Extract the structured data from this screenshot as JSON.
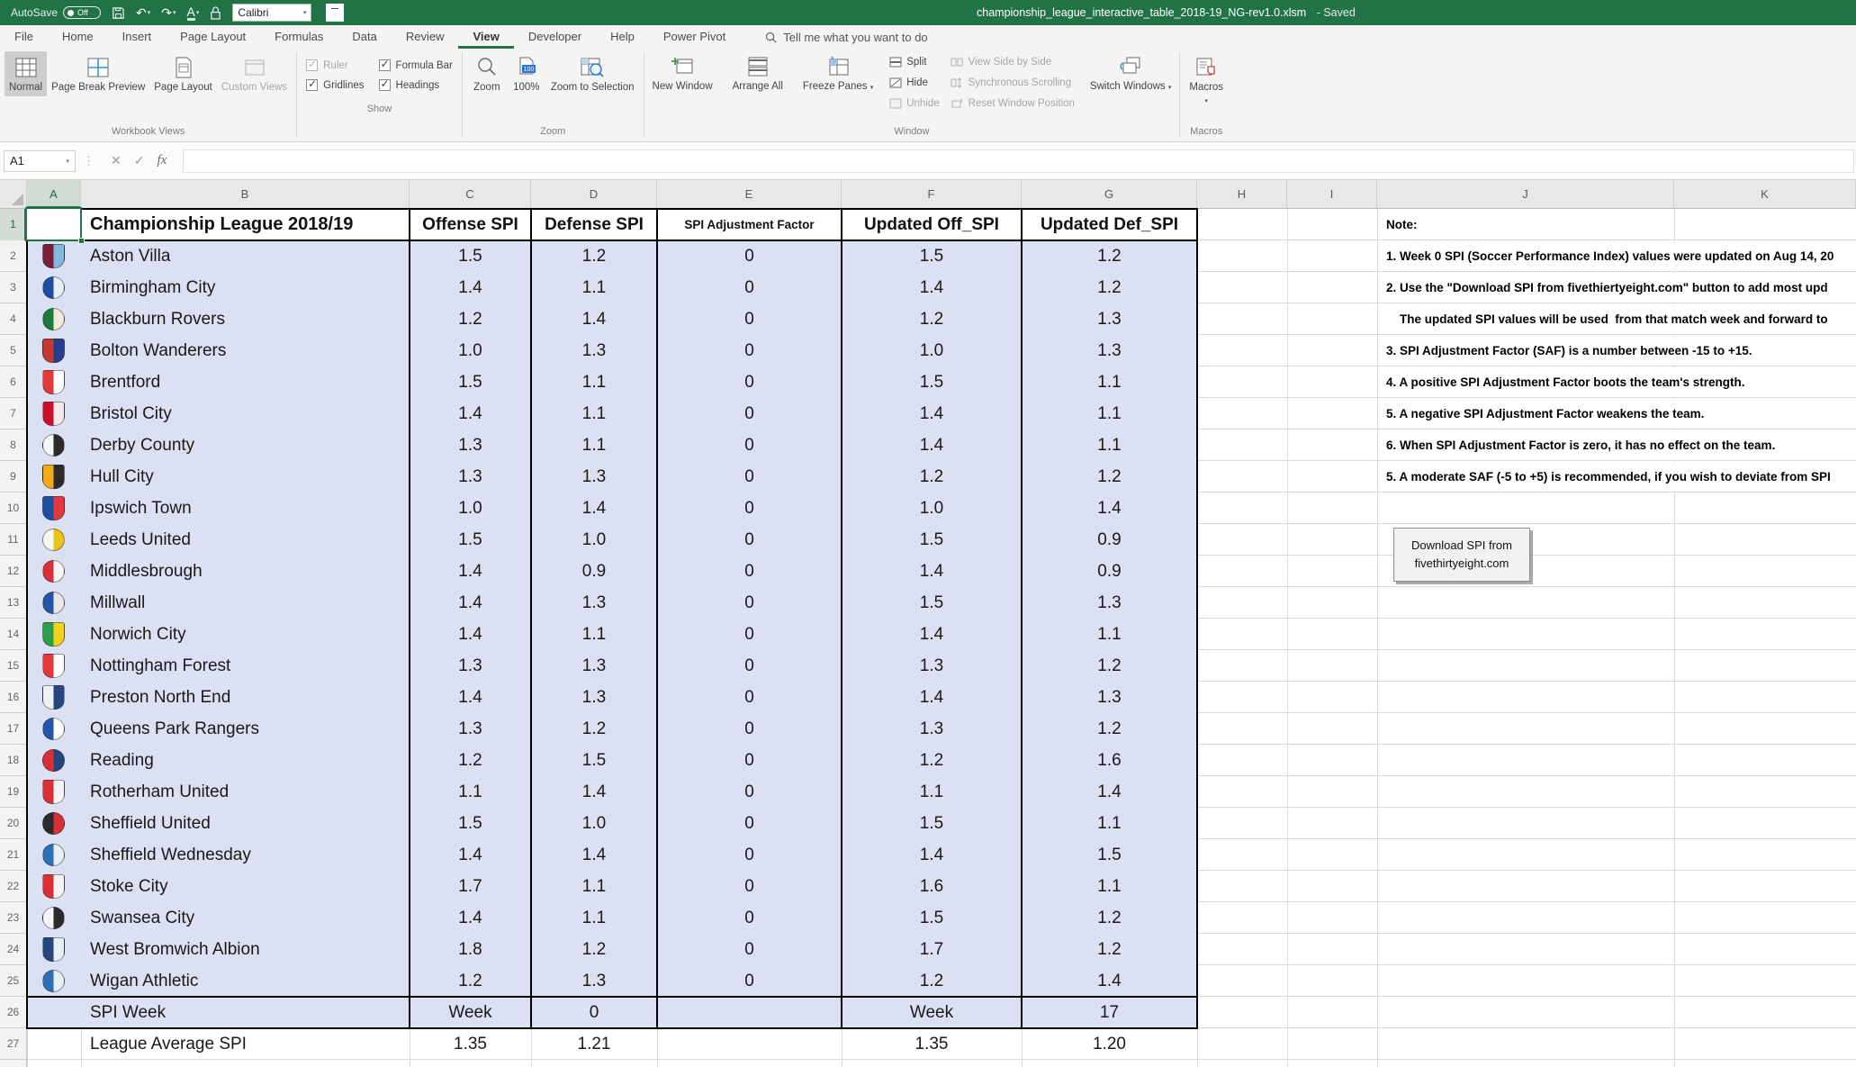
{
  "titlebar": {
    "autosave": "AutoSave",
    "autosave_state": "Off",
    "font_box": "Calibri",
    "filename": "championship_league_interactive_table_2018-19_NG-rev1.0.xlsm",
    "status": "- Saved"
  },
  "tabs": {
    "items": [
      "File",
      "Home",
      "Insert",
      "Page Layout",
      "Formulas",
      "Data",
      "Review",
      "View",
      "Developer",
      "Help",
      "Power Pivot"
    ],
    "active": "View",
    "tell_me": "Tell me what you want to do"
  },
  "ribbon": {
    "groups": {
      "workbook_views": {
        "label": "Workbook Views",
        "normal": "Normal",
        "page_break": "Page Break Preview",
        "page_layout": "Page Layout",
        "custom_views": "Custom Views"
      },
      "show": {
        "label": "Show",
        "ruler": "Ruler",
        "formula_bar": "Formula Bar",
        "gridlines": "Gridlines",
        "headings": "Headings"
      },
      "zoom": {
        "label": "Zoom",
        "zoom": "Zoom",
        "hundred": "100%",
        "zoom_to_selection": "Zoom to Selection"
      },
      "window": {
        "label": "Window",
        "new_window": "New Window",
        "arrange_all": "Arrange All",
        "freeze_panes": "Freeze Panes",
        "split": "Split",
        "hide": "Hide",
        "unhide": "Unhide",
        "side_by_side": "View Side by Side",
        "sync_scroll": "Synchronous Scrolling",
        "reset_position": "Reset Window Position",
        "switch_windows": "Switch Windows"
      },
      "macros": {
        "label": "Macros",
        "macros": "Macros"
      }
    }
  },
  "formula_bar": {
    "name_box": "A1"
  },
  "sheet": {
    "column_letters": [
      "A",
      "B",
      "C",
      "D",
      "E",
      "F",
      "G",
      "H",
      "I",
      "J",
      "K"
    ],
    "row_count": 27,
    "selected_cell": "A1",
    "table": {
      "title": "Championship League 2018/19",
      "headers": {
        "offense": "Offense SPI",
        "defense": "Defense SPI",
        "saf": "SPI Adjustment Factor",
        "updated_off": "Updated Off_SPI",
        "updated_def": "Updated Def_SPI"
      },
      "teams": [
        {
          "name": "Aston Villa",
          "offense": "1.5",
          "defense": "1.2",
          "saf": "0",
          "updated_off": "1.5",
          "updated_def": "1.2",
          "shape": "shield",
          "c1": "#7b1e3b",
          "c2": "#86b8dd"
        },
        {
          "name": "Birmingham City",
          "offense": "1.4",
          "defense": "1.1",
          "saf": "0",
          "updated_off": "1.4",
          "updated_def": "1.2",
          "shape": "circle",
          "c1": "#1d4f9e",
          "c2": "#e8eef5"
        },
        {
          "name": "Blackburn Rovers",
          "offense": "1.2",
          "defense": "1.4",
          "saf": "0",
          "updated_off": "1.2",
          "updated_def": "1.3",
          "shape": "circle",
          "c1": "#1c7a3d",
          "c2": "#f2ead8"
        },
        {
          "name": "Bolton Wanderers",
          "offense": "1.0",
          "defense": "1.3",
          "saf": "0",
          "updated_off": "1.0",
          "updated_def": "1.3",
          "shape": "shield",
          "c1": "#c23a32",
          "c2": "#243e8b"
        },
        {
          "name": "Brentford",
          "offense": "1.5",
          "defense": "1.1",
          "saf": "0",
          "updated_off": "1.5",
          "updated_def": "1.1",
          "shape": "shield",
          "c1": "#e03a3e",
          "c2": "#ffffff"
        },
        {
          "name": "Bristol City",
          "offense": "1.4",
          "defense": "1.1",
          "saf": "0",
          "updated_off": "1.4",
          "updated_def": "1.1",
          "shape": "shield",
          "c1": "#c8102e",
          "c2": "#f4e9e9"
        },
        {
          "name": "Derby County",
          "offense": "1.3",
          "defense": "1.1",
          "saf": "0",
          "updated_off": "1.4",
          "updated_def": "1.1",
          "shape": "circle",
          "c1": "#f5f5f5",
          "c2": "#2b2b2b"
        },
        {
          "name": "Hull City",
          "offense": "1.3",
          "defense": "1.3",
          "saf": "0",
          "updated_off": "1.2",
          "updated_def": "1.2",
          "shape": "shield",
          "c1": "#f1a91e",
          "c2": "#2b2b2b"
        },
        {
          "name": "Ipswich Town",
          "offense": "1.0",
          "defense": "1.4",
          "saf": "0",
          "updated_off": "1.0",
          "updated_def": "1.4",
          "shape": "shield",
          "c1": "#1d4f9e",
          "c2": "#e03a3e"
        },
        {
          "name": "Leeds United",
          "offense": "1.5",
          "defense": "1.0",
          "saf": "0",
          "updated_off": "1.5",
          "updated_def": "0.9",
          "shape": "circle",
          "c1": "#f7f7f2",
          "c2": "#e8c51c"
        },
        {
          "name": "Middlesbrough",
          "offense": "1.4",
          "defense": "0.9",
          "saf": "0",
          "updated_off": "1.4",
          "updated_def": "0.9",
          "shape": "circle",
          "c1": "#d93038",
          "c2": "#f5f5f5"
        },
        {
          "name": "Millwall",
          "offense": "1.4",
          "defense": "1.3",
          "saf": "0",
          "updated_off": "1.5",
          "updated_def": "1.3",
          "shape": "circle",
          "c1": "#2456a5",
          "c2": "#e8e8e8"
        },
        {
          "name": "Norwich City",
          "offense": "1.4",
          "defense": "1.1",
          "saf": "0",
          "updated_off": "1.4",
          "updated_def": "1.1",
          "shape": "shield",
          "c1": "#2f9e4a",
          "c2": "#f0d31f"
        },
        {
          "name": "Nottingham Forest",
          "offense": "1.3",
          "defense": "1.3",
          "saf": "0",
          "updated_off": "1.3",
          "updated_def": "1.2",
          "shape": "shield",
          "c1": "#e03a3e",
          "c2": "#ffffff"
        },
        {
          "name": "Preston North End",
          "offense": "1.4",
          "defense": "1.3",
          "saf": "0",
          "updated_off": "1.4",
          "updated_def": "1.3",
          "shape": "shield",
          "c1": "#eef2f7",
          "c2": "#26477d"
        },
        {
          "name": "Queens Park Rangers",
          "offense": "1.3",
          "defense": "1.2",
          "saf": "0",
          "updated_off": "1.3",
          "updated_def": "1.2",
          "shape": "circle",
          "c1": "#2456a5",
          "c2": "#ffffff"
        },
        {
          "name": "Reading",
          "offense": "1.2",
          "defense": "1.5",
          "saf": "0",
          "updated_off": "1.2",
          "updated_def": "1.6",
          "shape": "circle",
          "c1": "#d93038",
          "c2": "#26477d"
        },
        {
          "name": "Rotherham United",
          "offense": "1.1",
          "defense": "1.4",
          "saf": "0",
          "updated_off": "1.1",
          "updated_def": "1.4",
          "shape": "shield",
          "c1": "#d93038",
          "c2": "#f5f5f5"
        },
        {
          "name": "Sheffield United",
          "offense": "1.5",
          "defense": "1.0",
          "saf": "0",
          "updated_off": "1.5",
          "updated_def": "1.1",
          "shape": "circle",
          "c1": "#2b2b2b",
          "c2": "#d93038"
        },
        {
          "name": "Sheffield Wednesday",
          "offense": "1.4",
          "defense": "1.4",
          "saf": "0",
          "updated_off": "1.4",
          "updated_def": "1.5",
          "shape": "circle",
          "c1": "#2f6fb5",
          "c2": "#e8eef5"
        },
        {
          "name": "Stoke City",
          "offense": "1.7",
          "defense": "1.1",
          "saf": "0",
          "updated_off": "1.6",
          "updated_def": "1.1",
          "shape": "shield",
          "c1": "#d93038",
          "c2": "#f5f5f5"
        },
        {
          "name": "Swansea City",
          "offense": "1.4",
          "defense": "1.1",
          "saf": "0",
          "updated_off": "1.5",
          "updated_def": "1.2",
          "shape": "circle",
          "c1": "#f5f5f5",
          "c2": "#2b2b2b"
        },
        {
          "name": "West Bromwich Albion",
          "offense": "1.8",
          "defense": "1.2",
          "saf": "0",
          "updated_off": "1.7",
          "updated_def": "1.2",
          "shape": "shield",
          "c1": "#26477d",
          "c2": "#e8eef5"
        },
        {
          "name": "Wigan Athletic",
          "offense": "1.2",
          "defense": "1.3",
          "saf": "0",
          "updated_off": "1.2",
          "updated_def": "1.4",
          "shape": "circle",
          "c1": "#2f6fb5",
          "c2": "#e8eef5"
        }
      ],
      "spi_week": {
        "label": "SPI Week",
        "week_label_1": "Week",
        "week_value_1": "0",
        "week_label_2": "Week",
        "week_value_2": "17"
      },
      "league_average": {
        "label": "League Average SPI",
        "offense": "1.35",
        "defense": "1.21",
        "updated_off": "1.35",
        "updated_def": "1.20"
      }
    },
    "notes": {
      "lines": [
        {
          "row": 1,
          "text": "Note:"
        },
        {
          "row": 2,
          "text": "1. Week 0 SPI (Soccer Performance Index) values were updated on Aug 14, 20"
        },
        {
          "row": 3,
          "text": "2. Use the \"Download SPI from fivethiertyeight.com\" button to add most upd"
        },
        {
          "row": 4,
          "text": "    The updated SPI values will be used  from that match week and forward to"
        },
        {
          "row": 5,
          "text": "3. SPI Adjustment Factor (SAF) is a number between -15 to +15."
        },
        {
          "row": 6,
          "text": "4. A positive SPI Adjustment Factor boots the team's strength."
        },
        {
          "row": 7,
          "text": "5. A negative SPI Adjustment Factor weakens the team."
        },
        {
          "row": 8,
          "text": "6. When SPI Adjustment Factor is zero, it has no effect on the team."
        },
        {
          "row": 9,
          "text": "5. A moderate SAF (-5 to +5) is recommended, if you wish to deviate from SPI"
        }
      ]
    },
    "download_button": {
      "line1": "Download SPI from",
      "line2": "fivethirtyeight.com"
    }
  },
  "colors": {
    "accent": "#217346",
    "table_fill": "#dbe1f3"
  }
}
